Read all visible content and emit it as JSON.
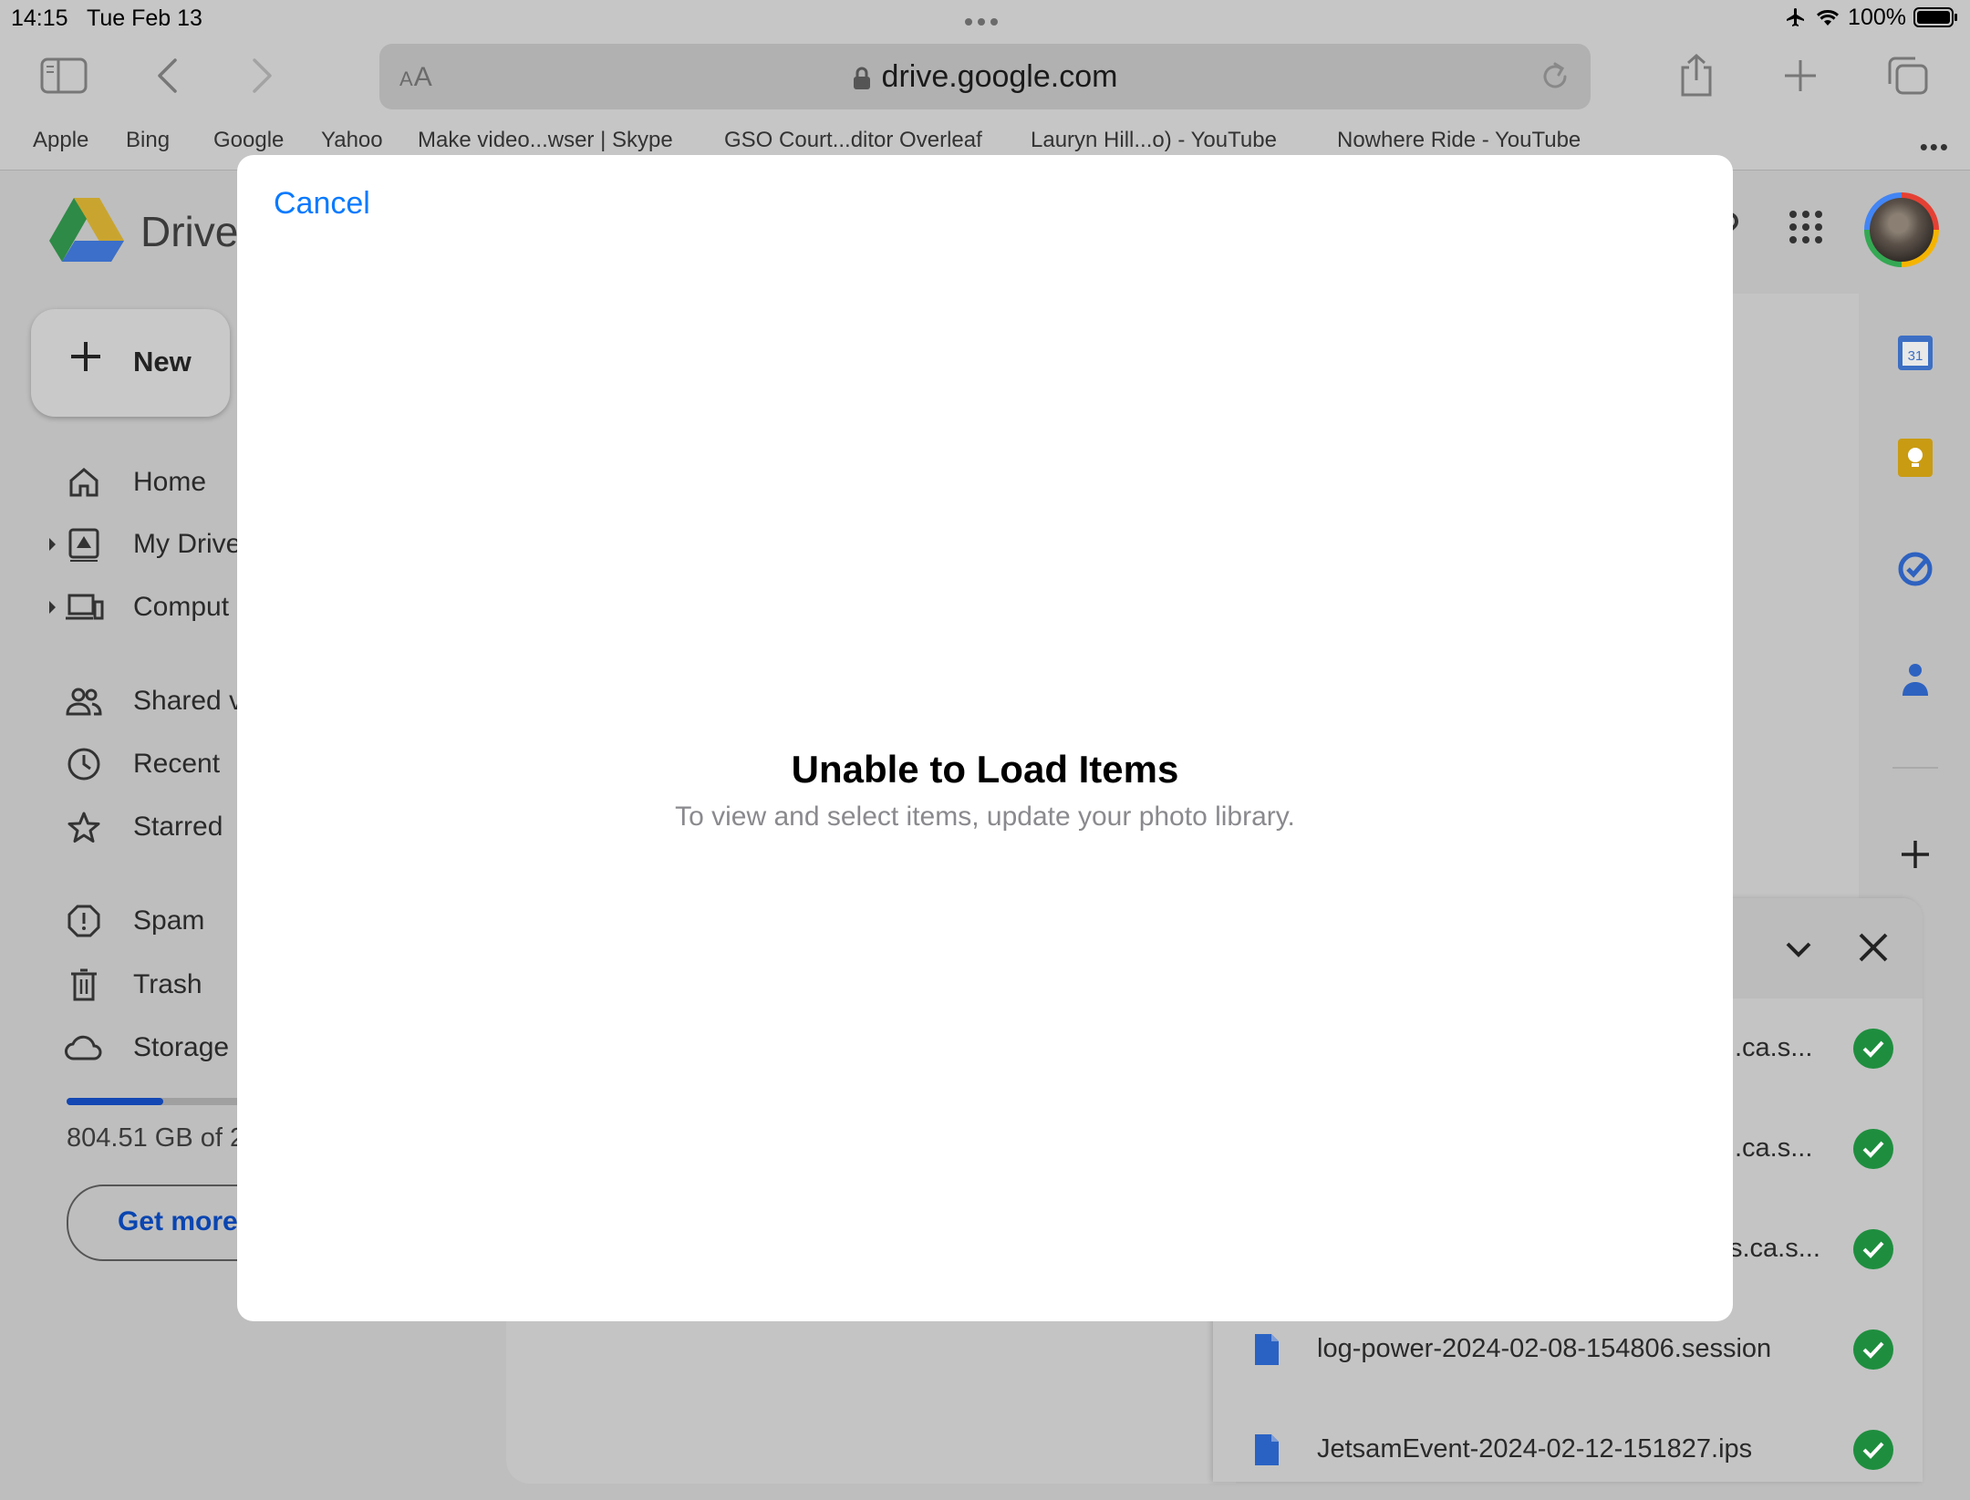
{
  "status_bar": {
    "time": "14:15",
    "date": "Tue Feb 13",
    "battery": "100%"
  },
  "browser": {
    "url": "drive.google.com",
    "text_size_label_small": "A",
    "text_size_label_large": "A",
    "bookmarks": [
      "Apple",
      "Bing",
      "Google",
      "Yahoo",
      "Make video...wser | Skype",
      "GSO Court...ditor Overleaf",
      "Lauryn Hill...o) - YouTube",
      "Nowhere Ride - YouTube"
    ]
  },
  "drive": {
    "title": "Drive",
    "new_label": "New",
    "nav": [
      {
        "label": "Home",
        "icon": "home-icon"
      },
      {
        "label": "My Drive",
        "icon": "my-drive-icon"
      },
      {
        "label": "Comput",
        "icon": "computers-icon"
      },
      {
        "label": "Shared v",
        "icon": "shared-icon"
      },
      {
        "label": "Recent",
        "icon": "recent-icon"
      },
      {
        "label": "Starred",
        "icon": "star-icon"
      },
      {
        "label": "Spam",
        "icon": "spam-icon"
      },
      {
        "label": "Trash",
        "icon": "trash-icon"
      },
      {
        "label": "Storage",
        "icon": "cloud-icon"
      }
    ],
    "storage_text": "804.51 GB of 2",
    "storage_used_fraction": 0.56,
    "get_more_label": "Get more",
    "calendar_day": "31",
    "uploads": [
      {
        "name": ".ca.s..."
      },
      {
        "name": ".ca.s..."
      },
      {
        "name": "s.ca.s..."
      },
      {
        "name": "log-power-2024-02-08-154806.session"
      },
      {
        "name": "JetsamEvent-2024-02-12-151827.ips"
      }
    ]
  },
  "modal": {
    "cancel_label": "Cancel",
    "title": "Unable to Load Items",
    "subtitle": "To view and select items, update your photo library."
  },
  "colors": {
    "accent": "#0a7aff",
    "drive_blue": "#0a45b0",
    "success_green": "#1e8e3e"
  }
}
